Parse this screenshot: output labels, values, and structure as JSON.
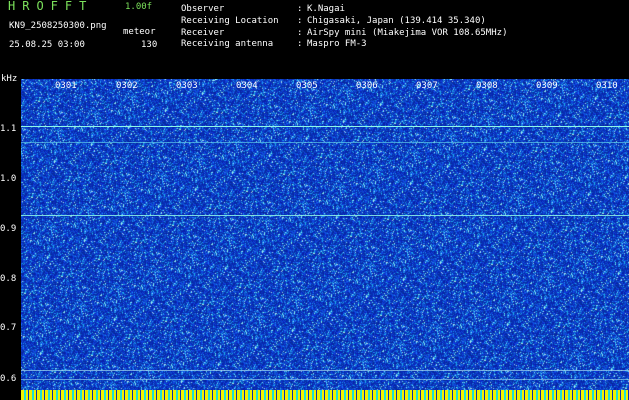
{
  "app": {
    "title": "HROFFT",
    "version": "1.00f"
  },
  "file": {
    "name": "KN9_2508250300.png",
    "datetime": "25.08.25 03:00"
  },
  "detection": {
    "label": "meteor",
    "count": "130"
  },
  "info": [
    {
      "label": "Observer",
      "value": "K.Nagai"
    },
    {
      "label": "Receiving Location",
      "value": "Chigasaki, Japan (139.414 35.340)"
    },
    {
      "label": "Receiver",
      "value": "AirSpy mini (Miakejima VOR 108.65MHz)"
    },
    {
      "label": "Receiving antenna",
      "value": "Maspro FM-3"
    }
  ],
  "separator": ":",
  "y_axis": {
    "unit": "kHz",
    "ticks": [
      "1.1",
      "1.0",
      "0.9",
      "0.8",
      "0.7",
      "0.6"
    ]
  },
  "x_axis": {
    "ticks": [
      "0301",
      "0302",
      "0303",
      "0304",
      "0305",
      "0306",
      "0307",
      "0308",
      "0309",
      "0310"
    ]
  },
  "colors": {
    "background": "#0a2fae",
    "signal": "#8ff7e8",
    "title_green": "#7be15b",
    "bar_yellow": "#f2f200"
  }
}
